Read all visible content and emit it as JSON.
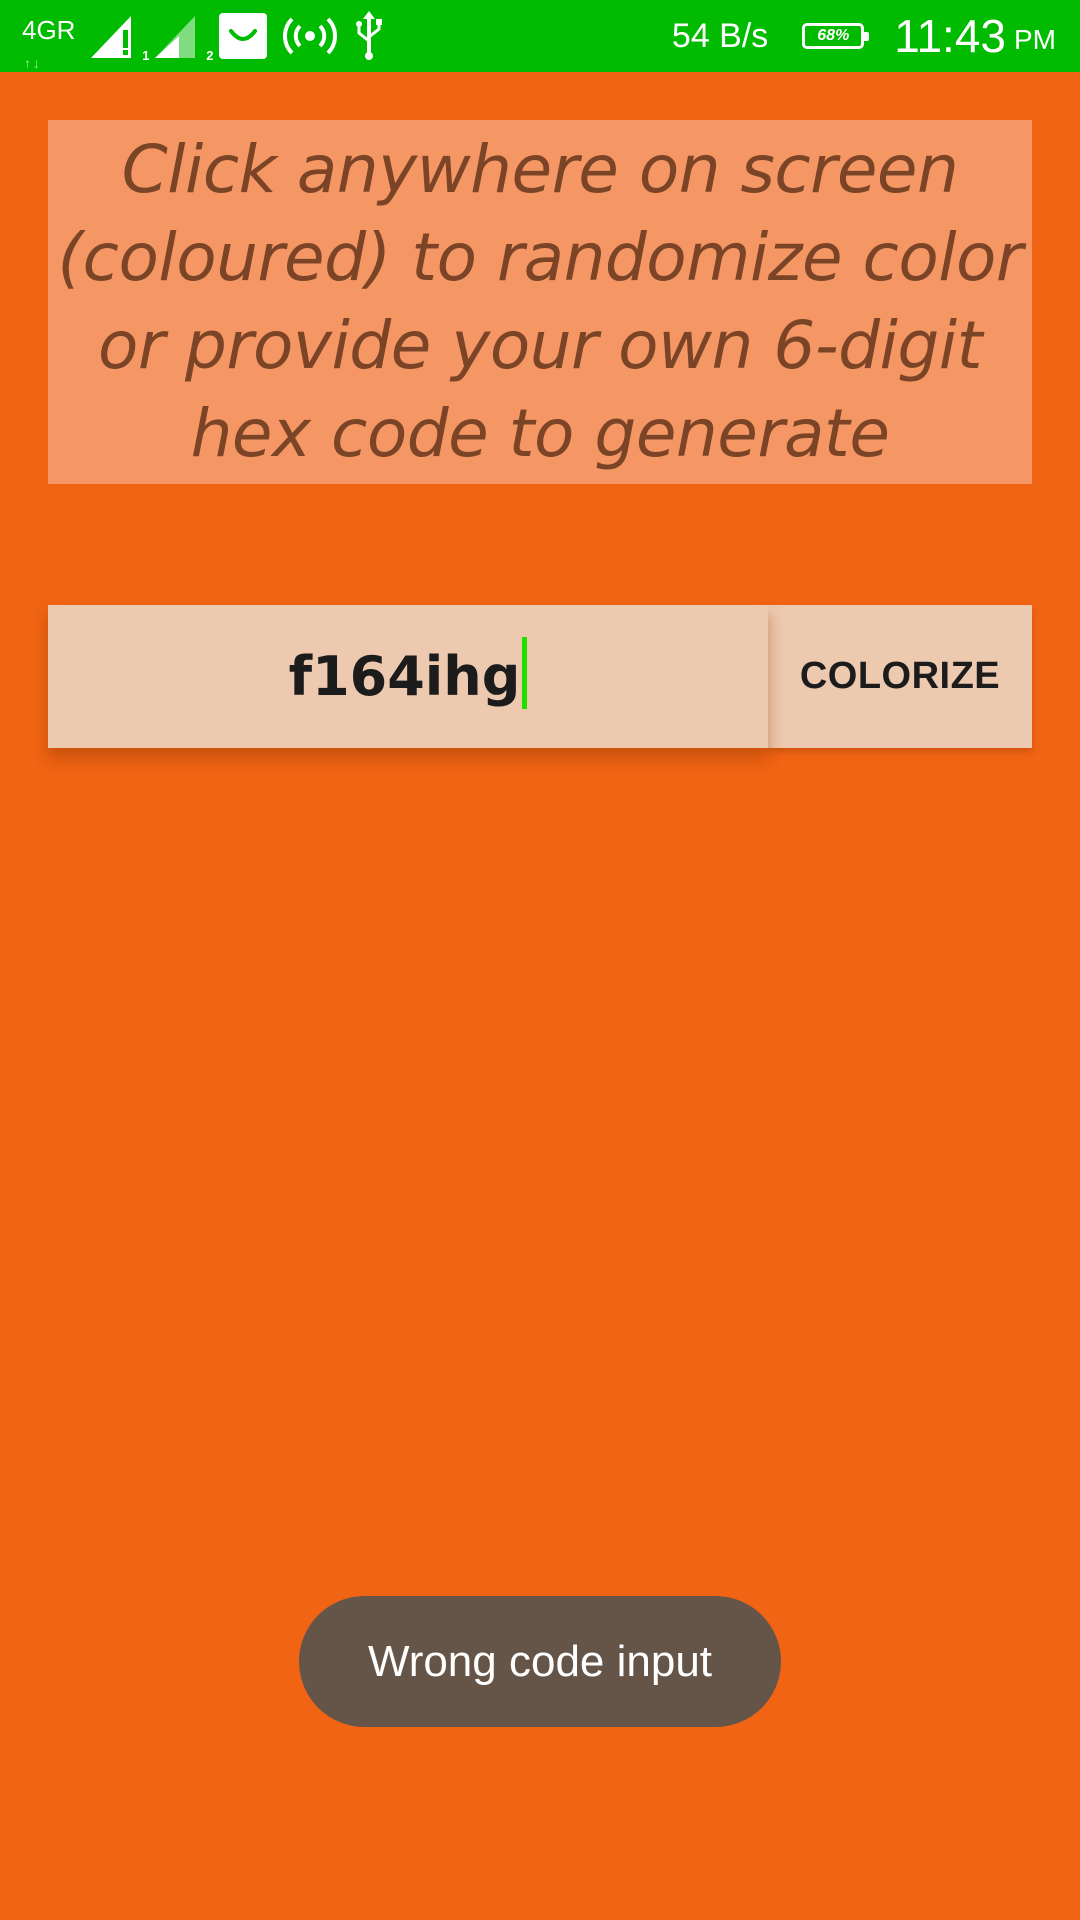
{
  "status_bar": {
    "network_type": "4GR",
    "sim1_label": "1",
    "sim2_label": "2",
    "net_speed": "54 B/s",
    "battery_percent": "68%",
    "time": "11:43",
    "ampm": "PM",
    "icons": [
      "network-4g-icon",
      "signal-sim1-icon",
      "signal-sim2-icon",
      "shopping-bag-icon",
      "hotspot-icon",
      "usb-icon",
      "battery-icon"
    ]
  },
  "instructions": {
    "text": "Click anywhere on screen (coloured) to randomize color or provide your own 6-digit hex code to generate"
  },
  "input": {
    "value": "f164ihg"
  },
  "colorize_button": {
    "label": "COLORIZE"
  },
  "toast": {
    "message": "Wrong code input"
  },
  "colors": {
    "background": "#f06414",
    "status_bar": "#00bb00",
    "instruction_panel": "#f59764",
    "instruction_text": "#7b4427",
    "input_background": "#edc9b0",
    "caret": "#22dd00",
    "toast_background": "#655548"
  }
}
